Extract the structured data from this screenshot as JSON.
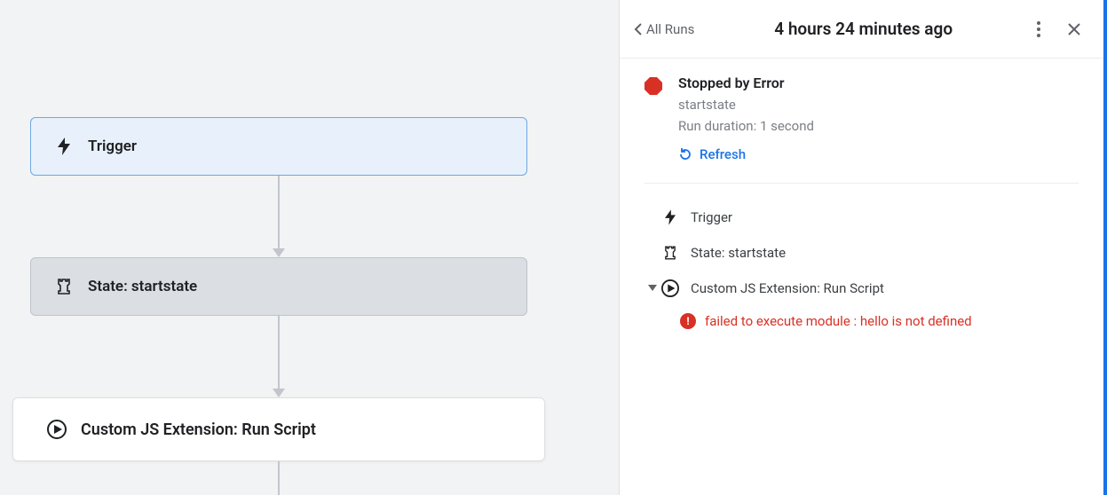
{
  "header": {
    "back_label": "All Runs",
    "title": "4 hours 24 minutes ago"
  },
  "status": {
    "heading": "Stopped by Error",
    "state_name": "startstate",
    "duration_label": "Run duration: 1 second",
    "refresh_label": "Refresh"
  },
  "steps": {
    "trigger_label": "Trigger",
    "state_label": "State: startstate",
    "action_label": "Custom JS Extension: Run Script",
    "error_message": "failed to execute module : hello is not defined"
  },
  "flow": {
    "trigger_label": "Trigger",
    "state_label": "State: startstate",
    "action_label": "Custom JS Extension: Run Script"
  },
  "colors": {
    "accent": "#1a73e8",
    "error": "#d93025"
  }
}
